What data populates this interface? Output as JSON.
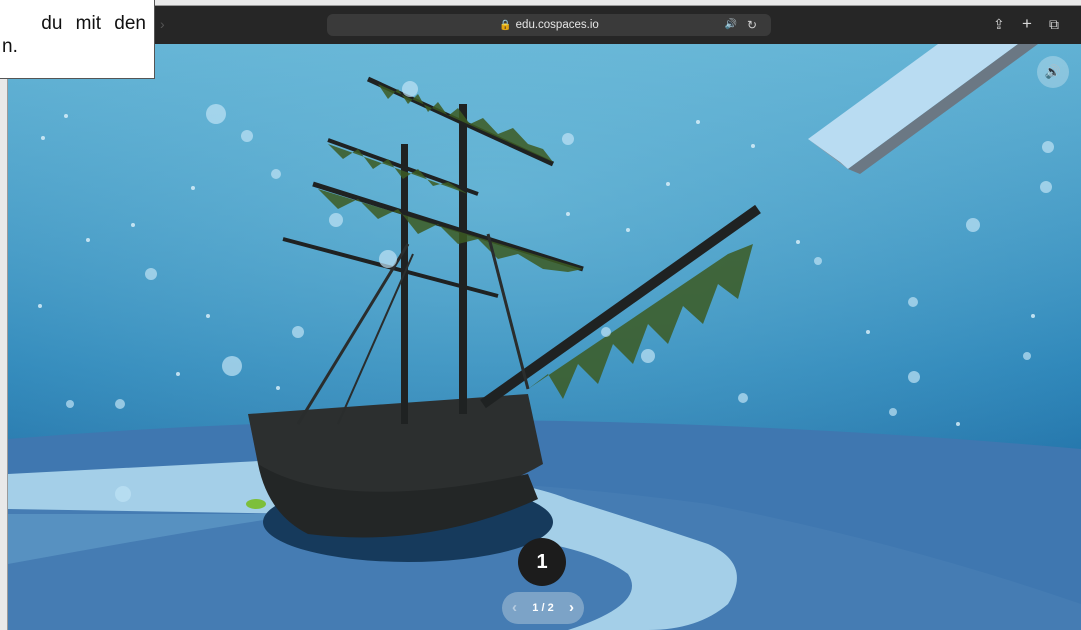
{
  "tooltip": {
    "line1": "du mit den",
    "line2": "n."
  },
  "browser": {
    "url": "edu.cospaces.io",
    "icons": {
      "forward": "chevron-right-icon",
      "lock": "lock-icon",
      "audio": "speaker-icon",
      "reload": "reload-icon",
      "share": "share-icon",
      "new_tab": "plus-icon",
      "tabs": "tabs-overview-icon"
    }
  },
  "scene": {
    "description_icons": {
      "sound": "speaker-icon"
    },
    "step_badge": "1",
    "pager": {
      "label": "1 / 2",
      "prev": "‹",
      "next": "›"
    }
  }
}
